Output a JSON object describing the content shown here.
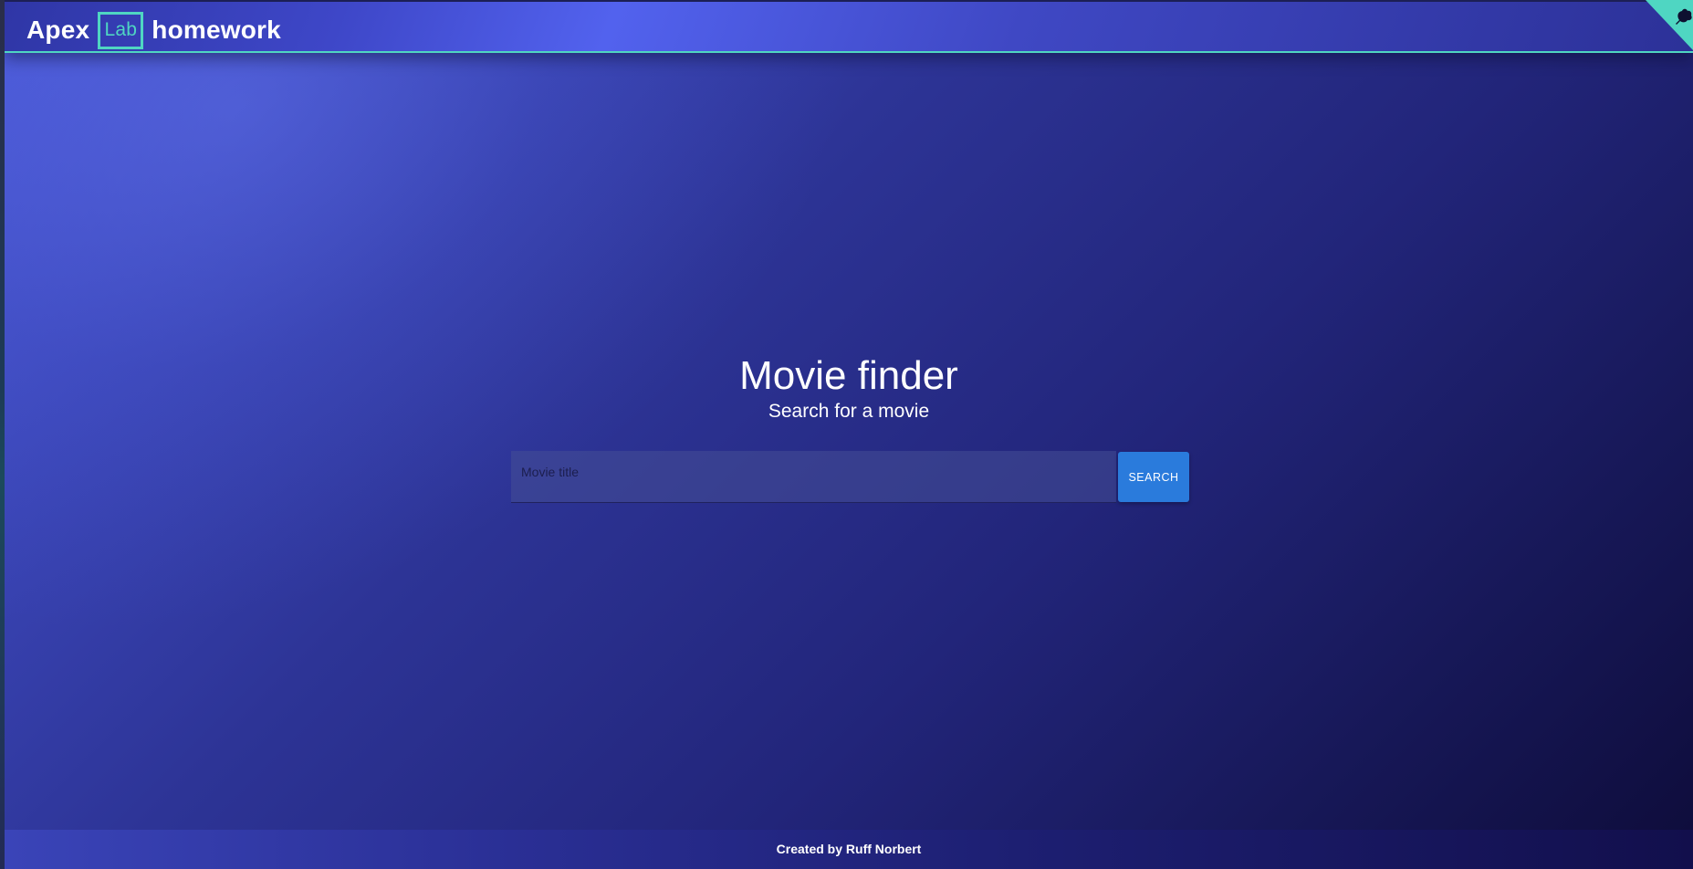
{
  "header": {
    "brand_prefix": "Apex",
    "brand_box": "Lab",
    "brand_suffix": "homework",
    "accent_color": "#4fd6c2"
  },
  "corner": {
    "icon": "ribbon-icon",
    "color": "#4fd6c2"
  },
  "hero": {
    "title": "Movie finder",
    "subtitle": "Search for a movie"
  },
  "search": {
    "placeholder": "Movie title",
    "value": "",
    "button_label": "SEARCH",
    "button_color": "#2a7bdc"
  },
  "footer": {
    "text": "Created by Ruff Norbert"
  }
}
